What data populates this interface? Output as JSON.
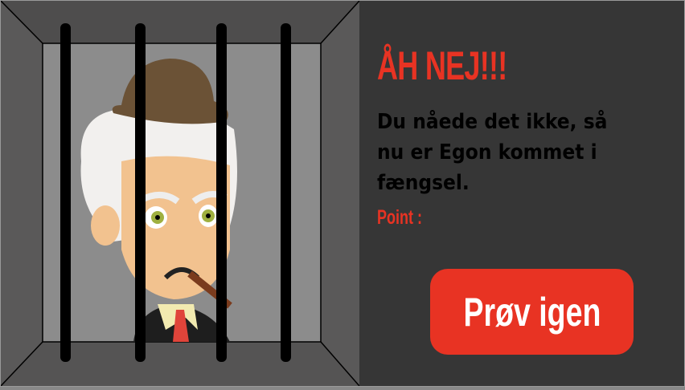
{
  "screen": {
    "title": "ÅH NEJ!!!",
    "message": "Du nåede det ikke, så nu er Egon kommet i fængsel.",
    "points_label": "Point :",
    "points_value": "",
    "retry_button": "Prøv igen"
  },
  "colors": {
    "accent": "#e83323",
    "panel": "#363636",
    "wall": "#8c8c8c",
    "frame": "#5a5959"
  }
}
